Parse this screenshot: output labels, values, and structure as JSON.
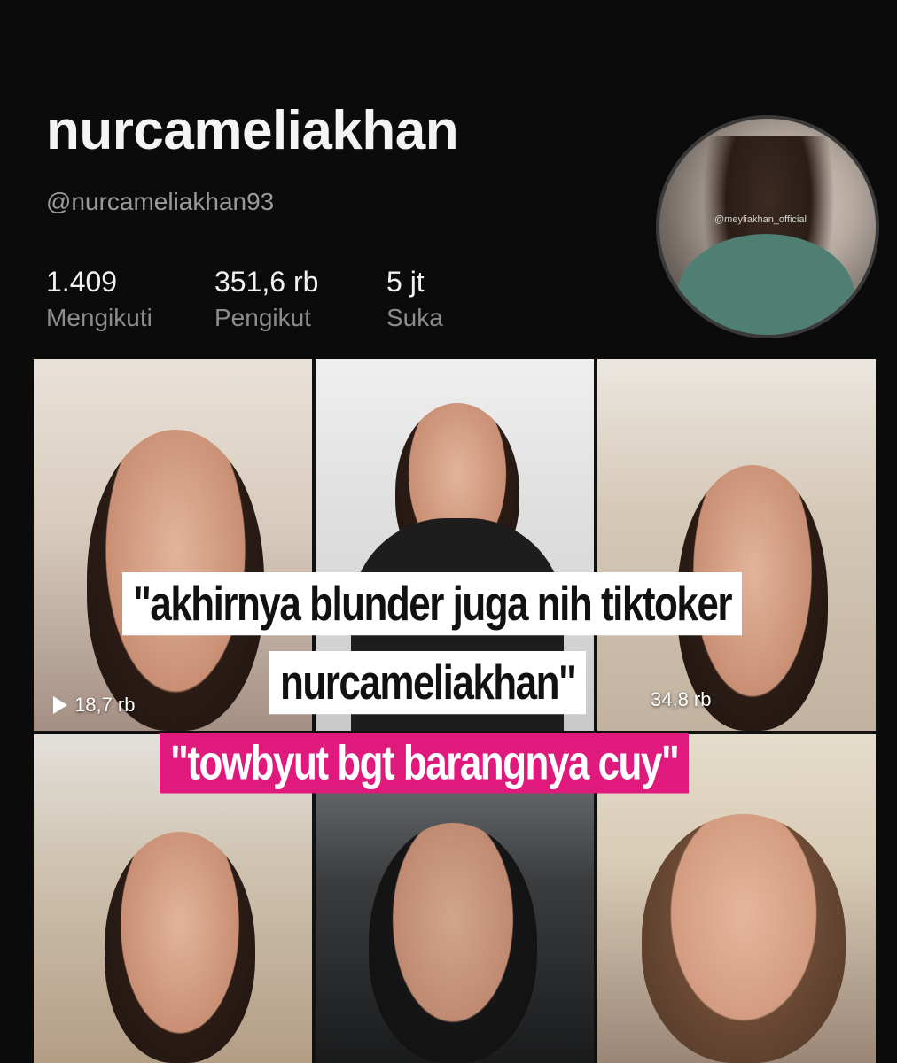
{
  "profile": {
    "display_name": "nurcameliakhan",
    "handle": "@nurcameliakhan93",
    "avatar_watermark": "@meyliakhan_official"
  },
  "stats": [
    {
      "value": "1.409",
      "label": "Mengikuti"
    },
    {
      "value": "351,6 rb",
      "label": "Pengikut"
    },
    {
      "value": "5 jt",
      "label": "Suka"
    }
  ],
  "videos": [
    {
      "views": "18,7 rb"
    },
    {
      "views": ""
    },
    {
      "views": "34,8 rb"
    },
    {
      "views": ""
    },
    {
      "views": ""
    },
    {
      "views": ""
    }
  ],
  "overlay": {
    "caption_line1": "\"akhirnya blunder juga nih tiktoker",
    "caption_line2": "nurcameliakhan\"",
    "caption_pink": "\"towbyut bgt barangnya cuy\""
  },
  "colors": {
    "background": "#0b0b0c",
    "caption_pink": "#e0197d"
  },
  "icons": [
    "play-icon"
  ]
}
